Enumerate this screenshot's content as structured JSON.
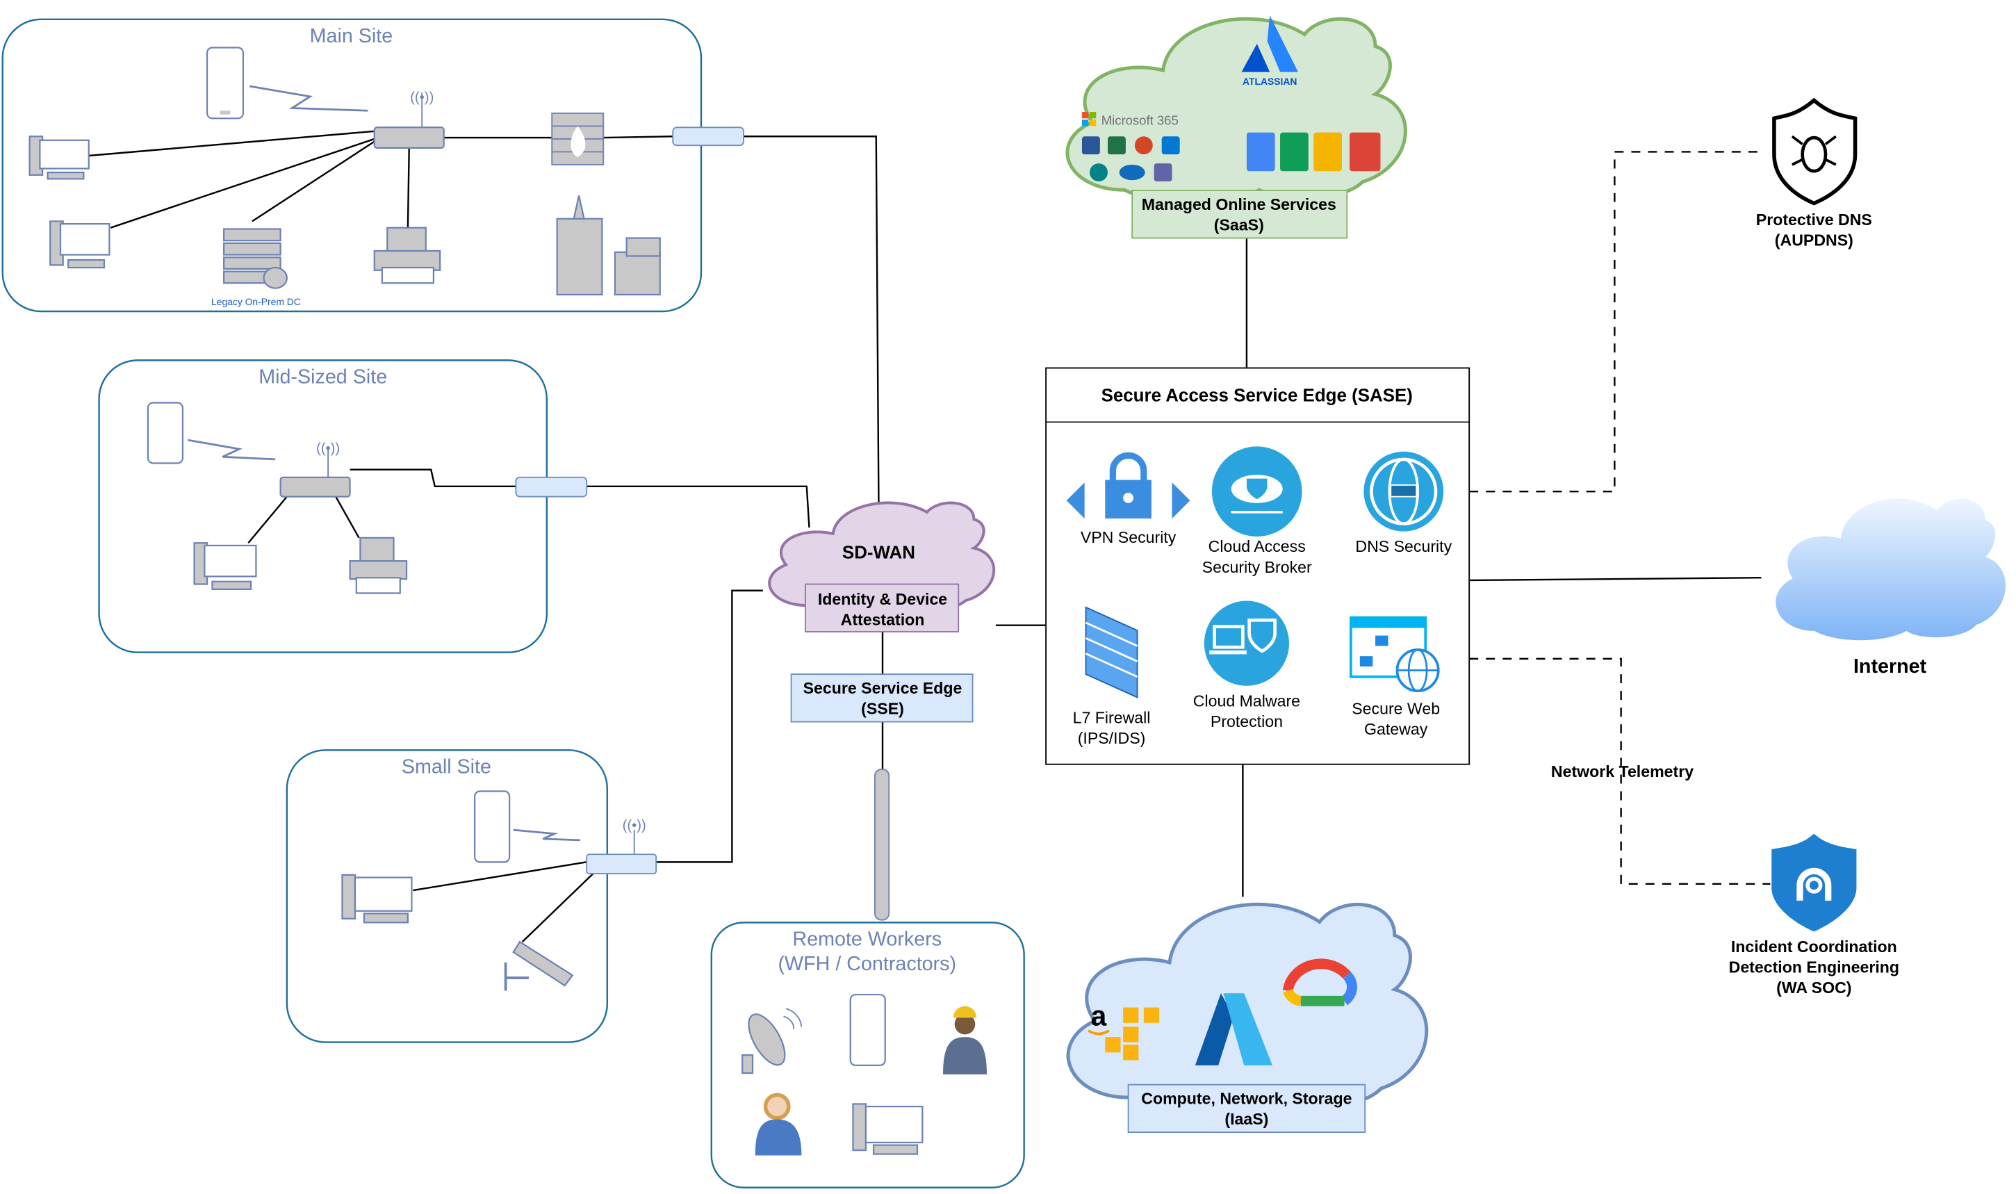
{
  "sites": {
    "main": {
      "title": "Main Site",
      "server_label": "Legacy On-Prem DC"
    },
    "mid": {
      "title": "Mid-Sized Site"
    },
    "small": {
      "title": "Small Site"
    },
    "remote": {
      "title_line1": "Remote Workers",
      "title_line2": "(WFH / Contractors)"
    }
  },
  "sdwan": {
    "title": "SD-WAN",
    "box_line1": "Identity & Device",
    "box_line2": "Attestation"
  },
  "sse": {
    "line1": "Secure Service Edge",
    "line2": "(SSE)"
  },
  "saas": {
    "ms365_label": "Microsoft 365",
    "atlassian_label": "ATLASSIAN",
    "line1": "Managed Online Services",
    "line2": "(SaaS)"
  },
  "sase": {
    "title": "Secure Access Service Edge (SASE)",
    "services": [
      {
        "label1": "VPN Security",
        "label2": "",
        "icon": "vpn-lock-icon"
      },
      {
        "label1": "Cloud Access",
        "label2": "Security Broker",
        "icon": "cloud-shield-icon"
      },
      {
        "label1": "DNS Security",
        "label2": "",
        "icon": "dns-globe-icon"
      },
      {
        "label1": "L7 Firewall",
        "label2": "(IPS/IDS)",
        "icon": "firewall-icon"
      },
      {
        "label1": "Cloud Malware",
        "label2": "Protection",
        "icon": "laptop-shield-icon"
      },
      {
        "label1": "Secure Web",
        "label2": "Gateway",
        "icon": "web-gateway-icon"
      }
    ]
  },
  "pdns": {
    "line1": "Protective DNS",
    "line2": "(AUPDNS)"
  },
  "internet": {
    "label": "Internet"
  },
  "telemetry": {
    "label": "Network Telemetry"
  },
  "soc": {
    "line1": "Incident Coordination",
    "line2": "Detection Engineering",
    "line3": "(WA SOC)"
  },
  "iaas": {
    "line1": "Compute, Network, Storage",
    "line2": "(IaaS)"
  },
  "colors": {
    "site_border": "#1f6f9c",
    "site_title": "#6c82b5",
    "sdwan_fill": "#e1d5e7",
    "sdwan_stroke": "#9673a6",
    "saas_fill": "#d5e8d4",
    "saas_stroke": "#82b366",
    "iaas_fill": "#dae8fc",
    "iaas_stroke": "#6c8ebf",
    "sase_icon_blue": "#2aa4de"
  }
}
